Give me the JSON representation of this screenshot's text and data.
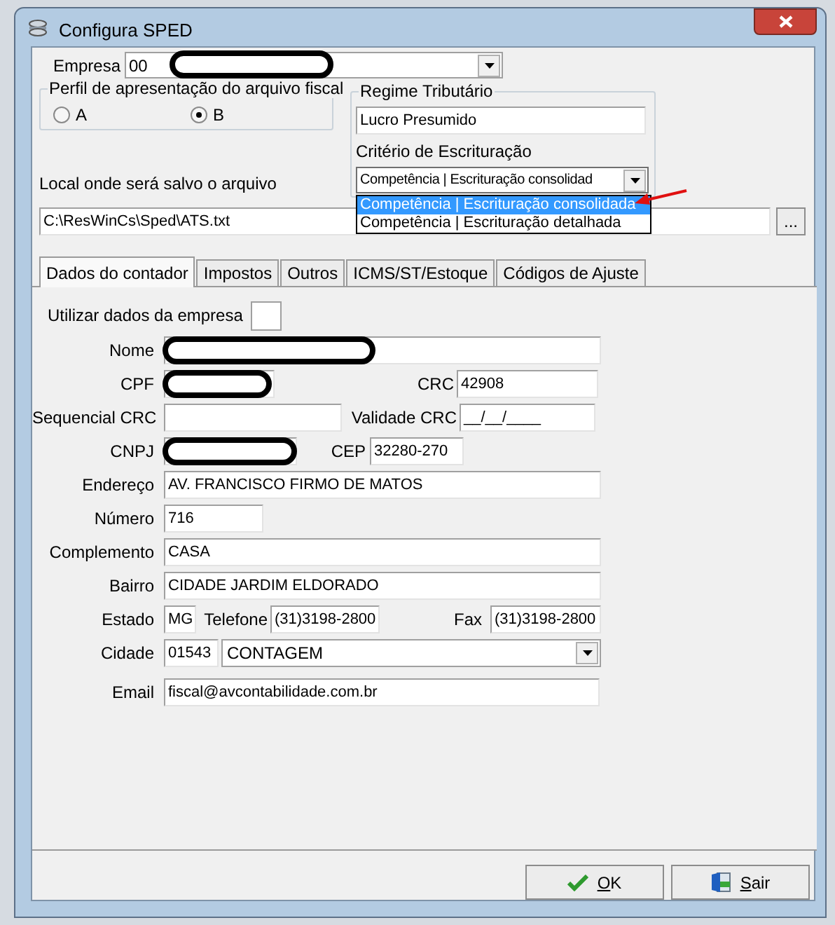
{
  "window": {
    "title": "Configura SPED"
  },
  "empresa": {
    "label": "Empresa",
    "code": "00",
    "name_redacted": true
  },
  "perfil": {
    "title": "Perfil de apresentação do arquivo fiscal",
    "options": [
      {
        "label": "A",
        "selected": false
      },
      {
        "label": "B",
        "selected": true
      }
    ]
  },
  "regime": {
    "title": "Regime Tributário",
    "value": "Lucro Presumido",
    "criterio_label": "Critério de Escrituração",
    "criterio_value": "Competência | Escrituração consolidad",
    "dropdown_open": true,
    "dropdown_options": [
      {
        "label": "Competência | Escrituração consolidada",
        "selected": true
      },
      {
        "label": "Competência | Escrituração detalhada",
        "selected": false
      }
    ]
  },
  "arquivo": {
    "label": "Local onde será salvo o arquivo",
    "value": "C:\\ResWinCs\\Sped\\ATS.txt",
    "browse": "..."
  },
  "tabs": [
    {
      "label": "Dados do contador",
      "selected": true
    },
    {
      "label": "Impostos",
      "selected": false
    },
    {
      "label": "Outros",
      "selected": false
    },
    {
      "label": "ICMS/ST/Estoque",
      "selected": false
    },
    {
      "label": "Códigos de Ajuste",
      "selected": false
    }
  ],
  "contador": {
    "utilizar": {
      "label": "Utilizar dados da empresa",
      "checked": false
    },
    "nome": {
      "label": "Nome",
      "redacted": true
    },
    "cpf": {
      "label": "CPF",
      "redacted": true
    },
    "crc": {
      "label": "CRC",
      "value": "42908"
    },
    "sequencial_crc": {
      "label": "Sequencial CRC"
    },
    "validade_crc": {
      "label": "Validade CRC",
      "value": "__/__/____"
    },
    "cnpj": {
      "label": "CNPJ",
      "redacted": true
    },
    "cep": {
      "label": "CEP",
      "value": "32280-270"
    },
    "endereco": {
      "label": "Endereço",
      "value": "AV. FRANCISCO FIRMO DE MATOS"
    },
    "numero": {
      "label": "Número",
      "value": "716"
    },
    "complemento": {
      "label": "Complemento",
      "value": "CASA"
    },
    "bairro": {
      "label": "Bairro",
      "value": "CIDADE JARDIM ELDORADO"
    },
    "estado": {
      "label": "Estado",
      "value": "MG"
    },
    "telefone": {
      "label": "Telefone",
      "value": "(31)3198-2800"
    },
    "fax": {
      "label": "Fax",
      "value": "(31)3198-2800"
    },
    "cidade": {
      "label": "Cidade",
      "code": "01543",
      "value": "CONTAGEM"
    },
    "email": {
      "label": "Email",
      "value": "fiscal@avcontabilidade.com.br"
    }
  },
  "buttons": [
    {
      "kind": "ok",
      "label": "OK"
    },
    {
      "kind": "exit",
      "label": "Sair"
    }
  ]
}
